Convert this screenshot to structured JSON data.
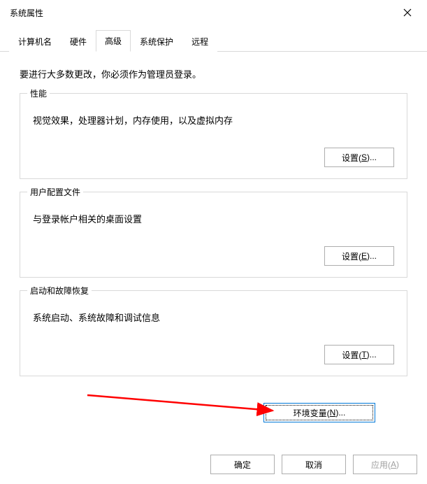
{
  "window": {
    "title": "系统属性"
  },
  "tabs": {
    "computer_name": "计算机名",
    "hardware": "硬件",
    "advanced": "高级",
    "system_protection": "系统保护",
    "remote": "远程"
  },
  "content": {
    "admin_notice": "要进行大多数更改，你必须作为管理员登录。",
    "performance": {
      "legend": "性能",
      "desc": "视觉效果，处理器计划，内存使用，以及虚拟内存",
      "button_prefix": "设置(",
      "button_key": "S",
      "button_suffix": ")..."
    },
    "user_profiles": {
      "legend": "用户配置文件",
      "desc": "与登录帐户相关的桌面设置",
      "button_prefix": "设置(",
      "button_key": "E",
      "button_suffix": ")..."
    },
    "startup_recovery": {
      "legend": "启动和故障恢复",
      "desc": "系统启动、系统故障和调试信息",
      "button_prefix": "设置(",
      "button_key": "T",
      "button_suffix": ")..."
    },
    "env_vars": {
      "button_prefix": "环境变量(",
      "button_key": "N",
      "button_suffix": ")..."
    }
  },
  "footer": {
    "ok": "确定",
    "cancel": "取消",
    "apply_prefix": "应用(",
    "apply_key": "A",
    "apply_suffix": ")"
  }
}
